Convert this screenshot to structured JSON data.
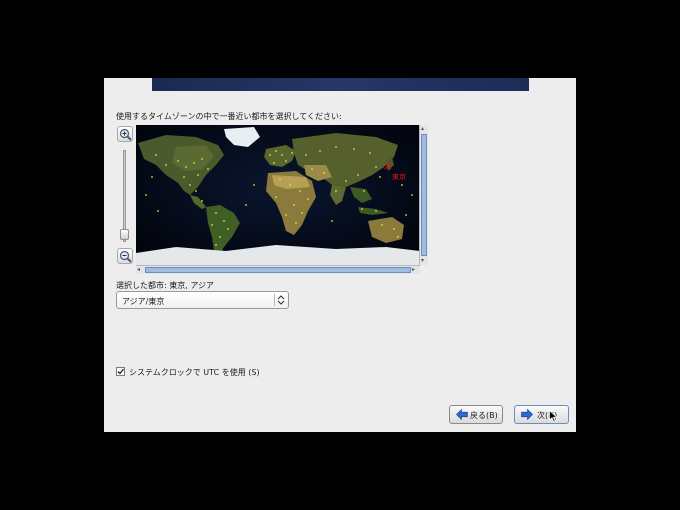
{
  "installer": {
    "instruction": "使用するタイムゾーンの中で一番近い都市を選択してください:",
    "selected_city_label": "選択した都市: 東京, アジア",
    "timezone_combo": {
      "value": "アジア/東京"
    },
    "map": {
      "highlight_city": "東京",
      "marker_color": "#e0141e",
      "city_dot_color": "#e6e62a"
    },
    "utc_checkbox": {
      "label": "システムクロックで UTC を使用 (S)",
      "checked": true
    },
    "buttons": {
      "back": "戻る(B)",
      "next": "次(N)"
    },
    "icons": {
      "zoom_in": "zoom-in-icon",
      "zoom_out": "zoom-out-icon",
      "back": "arrow-left-icon",
      "next": "arrow-right-icon"
    }
  }
}
